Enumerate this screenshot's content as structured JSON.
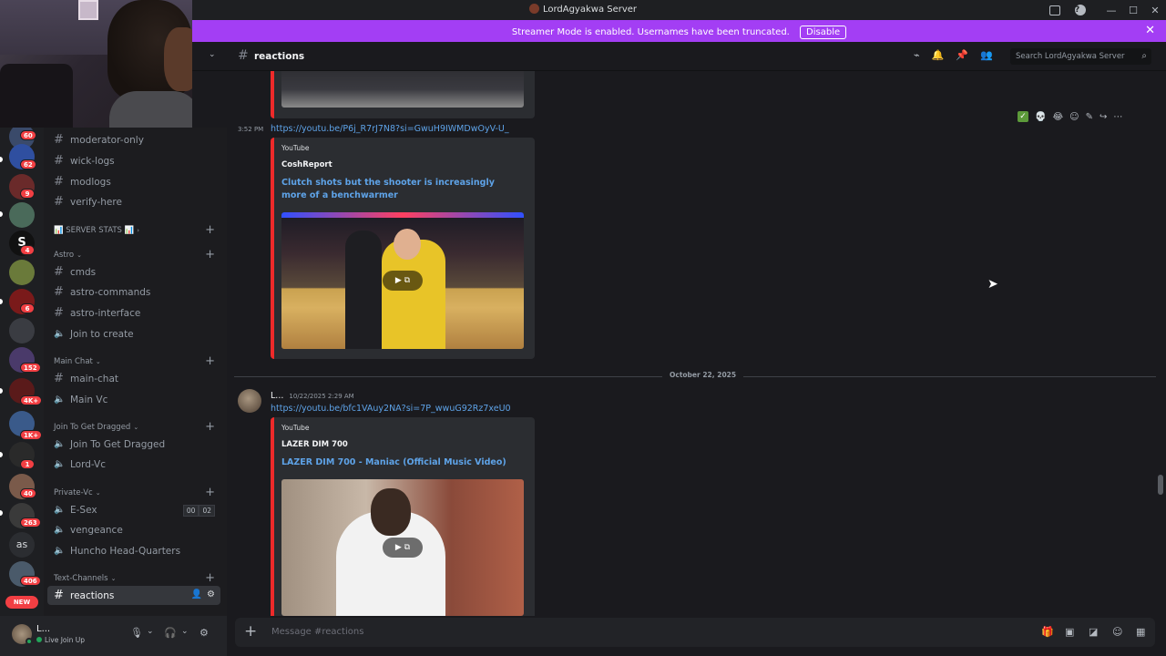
{
  "window": {
    "title": "LordAgyakwa Server",
    "controls": [
      "—",
      "☐",
      "✕"
    ]
  },
  "streamer_banner": {
    "message": "Streamer Mode is enabled. Usernames have been truncated.",
    "button": "Disable",
    "close": "✕"
  },
  "server_rail": {
    "badges": [
      "60",
      "62",
      "9",
      "4",
      "6",
      "152",
      "4K+",
      "1K+",
      "1",
      "40",
      "263",
      "406"
    ],
    "text_server": "as",
    "new_badge": "NEW"
  },
  "sidebar": {
    "channels_top": [
      "moderator-only",
      "wick-logs",
      "modlogs",
      "verify-here"
    ],
    "server_stats": "📊 SERVER STATS 📊",
    "cat_astro": "Astro",
    "astro_channels": [
      "cmds",
      "astro-commands",
      "astro-interface"
    ],
    "join_to_create": "Join to create",
    "cat_main_chat": "Main Chat",
    "main_chat": "main-chat",
    "main_vc": "Main Vc",
    "cat_join_dragged": "Join To Get Dragged",
    "join_dragged": "Join To Get Dragged",
    "lord_vc": "Lord-Vc",
    "cat_private": "Private-Vc",
    "private_channels": [
      "E-Sex",
      "vengeance",
      "Huncho Head-Quarters"
    ],
    "esex_counts": [
      "00",
      "02"
    ],
    "cat_text": "Text-Channels",
    "active_channel": "reactions"
  },
  "user": {
    "name": "L...",
    "status": "Live Join Up"
  },
  "channel_header": {
    "name": "reactions",
    "search_placeholder": "Search LordAgyakwa Server"
  },
  "messages": {
    "msg1": {
      "time": "3:52 PM",
      "link": "https://youtu.be/P6j_R7rJ7N8?si=GwuH9IWMDwOyV-U_",
      "provider": "YouTube",
      "author": "CoshReport",
      "title": "Clutch shots but the shooter is increasingly more of a benchwarmer"
    },
    "date_divider": "October 22, 2025",
    "msg2": {
      "author": "L...",
      "timestamp": "10/22/2025 2:29 AM",
      "link": "https://youtu.be/bfc1VAuy2NA?si=7P_wwuG92Rz7xeU0",
      "provider": "YouTube",
      "author_embed": "LAZER DIM 700",
      "title": "LAZER DIM 700 - Maniac (Official Music Video)"
    }
  },
  "composer": {
    "placeholder": "Message #reactions"
  },
  "colors": {
    "accent_streamer": "#a33ef4",
    "link": "#5ea3e8",
    "youtube_red": "#ee2a2a",
    "badge_red": "#f23f43"
  }
}
